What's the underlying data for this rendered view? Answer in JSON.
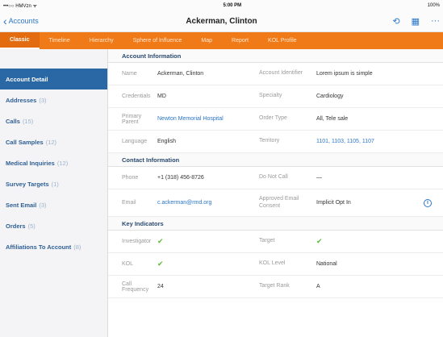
{
  "statusbar": {
    "carrier": "•••○○ HMVzn ᯤ",
    "time": "5:00 PM",
    "battery": "100%"
  },
  "navbar": {
    "back_label": "Accounts",
    "title": "Ackerman, Clinton",
    "icons": [
      "sync-icon",
      "calendar-icon",
      "more-icon"
    ]
  },
  "tabs": [
    "Classic",
    "Timeline",
    "Hierarchy",
    "Sphere of Influence",
    "Map",
    "Report",
    "KOL Profile"
  ],
  "sidebar": {
    "items": [
      {
        "label": "Account Detail",
        "count": ""
      },
      {
        "label": "Addresses",
        "count": "(3)"
      },
      {
        "label": "Calls",
        "count": "(15)"
      },
      {
        "label": "Call Samples",
        "count": "(12)"
      },
      {
        "label": "Medical Inquiries",
        "count": "(12)"
      },
      {
        "label": "Survey Targets",
        "count": "(1)"
      },
      {
        "label": "Sent Email",
        "count": "(3)"
      },
      {
        "label": "Orders",
        "count": "(5)"
      },
      {
        "label": "Affiliations To Account",
        "count": "(8)"
      }
    ]
  },
  "sections": {
    "account": {
      "title": "Account Information",
      "rows": [
        {
          "l1": "Name",
          "v1": "Ackerman, Clinton",
          "l2": "Account Identifier",
          "v2": "Lorem ipsum is simple"
        },
        {
          "l1": "Credentials",
          "v1": "MD",
          "l2": "Specialty",
          "v2": "Cardiology"
        },
        {
          "l1": "Primary Parent",
          "v1": "Newton Memorial Hospital",
          "l2": "Order Type",
          "v2": "All, Tele sale"
        },
        {
          "l1": "Language",
          "v1": "English",
          "l2": "Territory",
          "v2": "1101, 1103, 1105, 1107"
        }
      ]
    },
    "contact": {
      "title": "Contact Information",
      "rows": [
        {
          "l1": "Phone",
          "v1": "+1 (318) 456-8726",
          "l2": "Do Not Call",
          "v2": "—"
        },
        {
          "l1": "Email",
          "v1": "c.ackerman@rmd.org",
          "l2": "Approved Email Consent",
          "v2": "Implicit Opt In"
        }
      ]
    },
    "indicators": {
      "title": "Key Indicators",
      "rows": [
        {
          "l1": "Investigator",
          "v1": "✔",
          "l2": "Target",
          "v2": "✔"
        },
        {
          "l1": "KOL",
          "v1": "✔",
          "l2": "KOL Level",
          "v2": "National"
        },
        {
          "l1": "Call Frequency",
          "v1": "24",
          "l2": "Target Rank",
          "v2": "A"
        }
      ]
    }
  }
}
